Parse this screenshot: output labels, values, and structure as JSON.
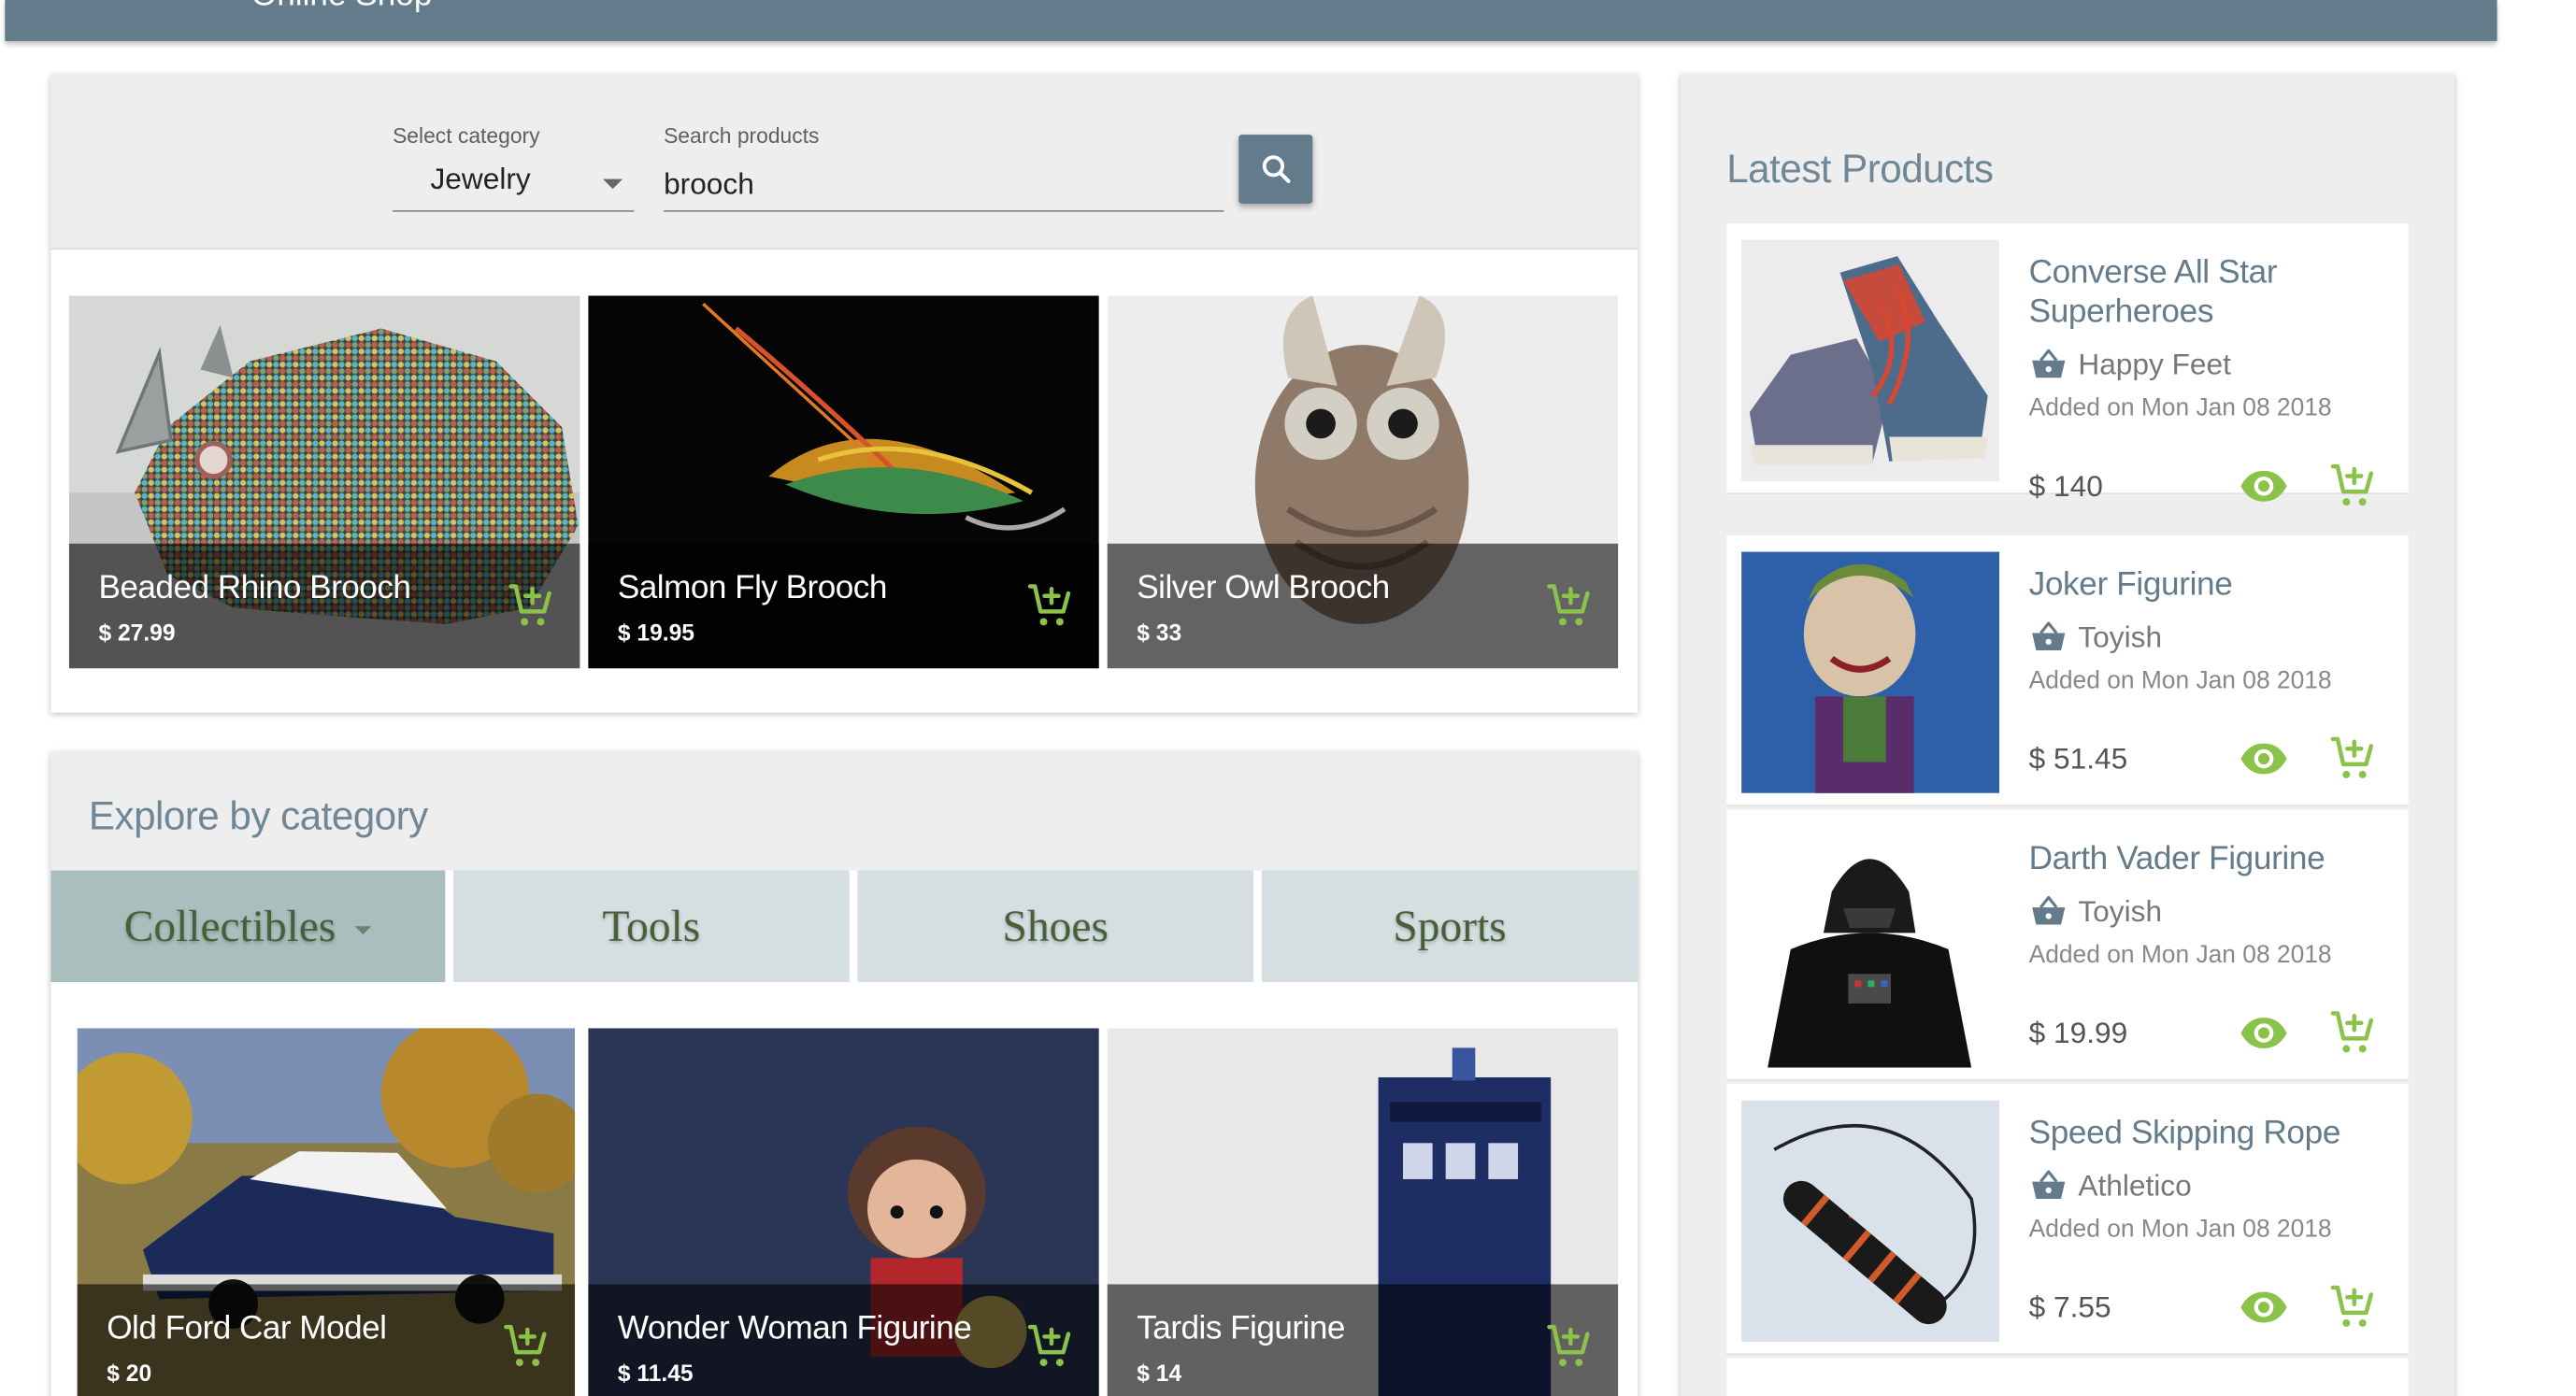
{
  "header": {
    "title": "Online Shop"
  },
  "search": {
    "category_label": "Select category",
    "category_value": "Jewelry",
    "search_label": "Search products",
    "search_value": "brooch"
  },
  "results": [
    {
      "name": "Beaded Rhino Brooch",
      "price": "$ 27.99"
    },
    {
      "name": "Salmon Fly Brooch",
      "price": "$ 19.95"
    },
    {
      "name": "Silver Owl Brooch",
      "price": "$ 33"
    }
  ],
  "explore": {
    "title": "Explore by category",
    "tabs": [
      {
        "label": "Collectibles",
        "active": true
      },
      {
        "label": "Tools"
      },
      {
        "label": "Shoes"
      },
      {
        "label": "Sports"
      }
    ],
    "products": [
      {
        "name": "Old Ford Car Model",
        "price": "$ 20"
      },
      {
        "name": "Wonder Woman Figurine",
        "price": "$ 11.45"
      },
      {
        "name": "Tardis Figurine",
        "price": "$ 14"
      }
    ]
  },
  "latest": {
    "title": "Latest Products",
    "items": [
      {
        "name": "Converse All Star Superheroes",
        "shop": "Happy Feet",
        "added": "Added on Mon Jan 08 2018",
        "price": "$ 140"
      },
      {
        "name": "Joker Figurine",
        "shop": "Toyish",
        "added": "Added on Mon Jan 08 2018",
        "price": "$ 51.45"
      },
      {
        "name": "Darth Vader Figurine",
        "shop": "Toyish",
        "added": "Added on Mon Jan 08 2018",
        "price": "$ 19.99"
      },
      {
        "name": "Speed Skipping Rope",
        "shop": "Athletico",
        "added": "Added on Mon Jan 08 2018",
        "price": "$ 7.55"
      }
    ]
  },
  "colors": {
    "header": "#637b8b",
    "accent_green": "#8bc34a",
    "title_blue": "#637b8b",
    "active_tab": "#a9bfbe",
    "tab": "#d5dee1"
  },
  "icons": [
    "search-icon",
    "add-to-cart-icon",
    "view-icon",
    "shop-basket-icon",
    "chevron-down-icon"
  ]
}
